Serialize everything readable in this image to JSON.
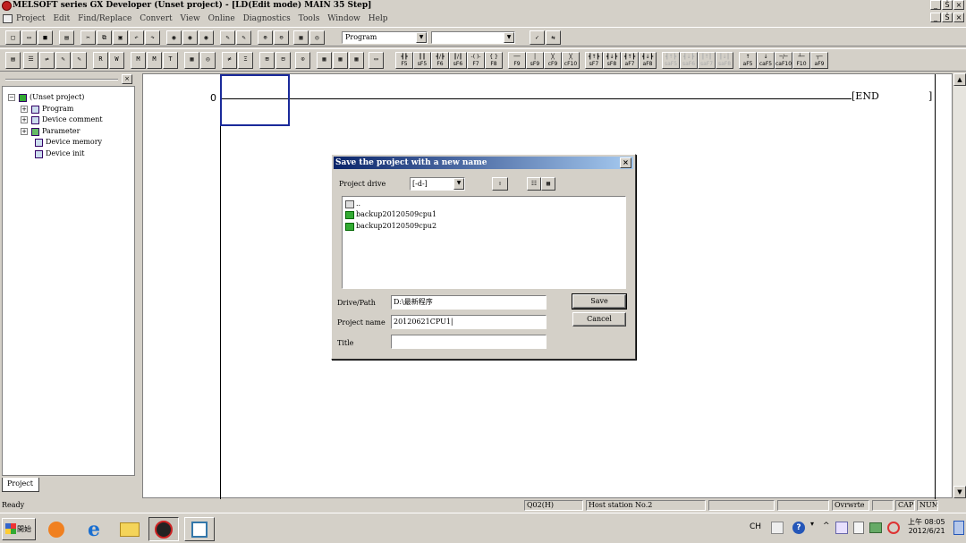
{
  "window": {
    "title": "MELSOFT series GX Developer (Unset project) - [LD(Edit mode)    MAIN    35 Step]",
    "minimize": "_",
    "restore": "Š",
    "close": "×"
  },
  "menu": [
    "Project",
    "Edit",
    "Find/Replace",
    "Convert",
    "View",
    "Online",
    "Diagnostics",
    "Tools",
    "Window",
    "Help"
  ],
  "toolbar": {
    "program_combo": "Program",
    "second_combo": "",
    "fkeys": [
      {
        "top": "┫┣",
        "bottom": "F5"
      },
      {
        "top": "║║",
        "bottom": "sF5"
      },
      {
        "top": "┫/┣",
        "bottom": "F6"
      },
      {
        "top": "║/║",
        "bottom": "sF6"
      },
      {
        "top": "-( )-",
        "bottom": "F7"
      },
      {
        "top": "{ }",
        "bottom": "F8"
      },
      {
        "top": "──",
        "bottom": "F9"
      },
      {
        "top": "│",
        "bottom": "sF9"
      },
      {
        "top": "╳",
        "bottom": "cF9"
      },
      {
        "top": "╳",
        "bottom": "cF10"
      },
      {
        "top": "┫↑┣",
        "bottom": "sF7"
      },
      {
        "top": "┫↓┣",
        "bottom": "sF8"
      },
      {
        "top": "┫↑┣",
        "bottom": "aF7"
      },
      {
        "top": "┫↓┣",
        "bottom": "aF8"
      },
      {
        "top": "┫↑┣",
        "bottom": "saF5"
      },
      {
        "top": "┫↓┣",
        "bottom": "saF6"
      },
      {
        "top": "║↑║",
        "bottom": "saF7"
      },
      {
        "top": "║↓║",
        "bottom": "saF8"
      },
      {
        "top": "↑",
        "bottom": "aF5"
      },
      {
        "top": "↓",
        "bottom": "caF5"
      },
      {
        "top": "─/─",
        "bottom": "caF10"
      },
      {
        "top": "┴─",
        "bottom": "F10"
      },
      {
        "top": "┬─",
        "bottom": "aF9"
      }
    ]
  },
  "project_tree": {
    "root": "(Unset project)",
    "items": [
      "Program",
      "Device comment",
      "Parameter",
      "Device memory",
      "Device init"
    ],
    "tab": "Project"
  },
  "ladder": {
    "step": "0",
    "end_label": "END"
  },
  "dialog": {
    "title": "Save the project with a new name",
    "drive_label": "Project drive",
    "drive_value": "[-d-]",
    "files": [
      "..",
      "backup20120509cpu1",
      "backup20120509cpu2"
    ],
    "path_label": "Drive/Path",
    "path_value": "D:\\最新程序",
    "name_label": "Project name",
    "name_value": "20120621CPU1|",
    "title_label": "Title",
    "title_value": "",
    "save": "Save",
    "cancel": "Cancel"
  },
  "status": {
    "ready": "Ready",
    "cpu": "Q02(H)",
    "station": "Host station No.2",
    "mode": "Ovrwrte",
    "cap": "CAP",
    "num": "NUM"
  },
  "taskbar": {
    "start": "開始",
    "lang": "CH",
    "time": "上午 08:05",
    "date": "2012/6/21"
  }
}
